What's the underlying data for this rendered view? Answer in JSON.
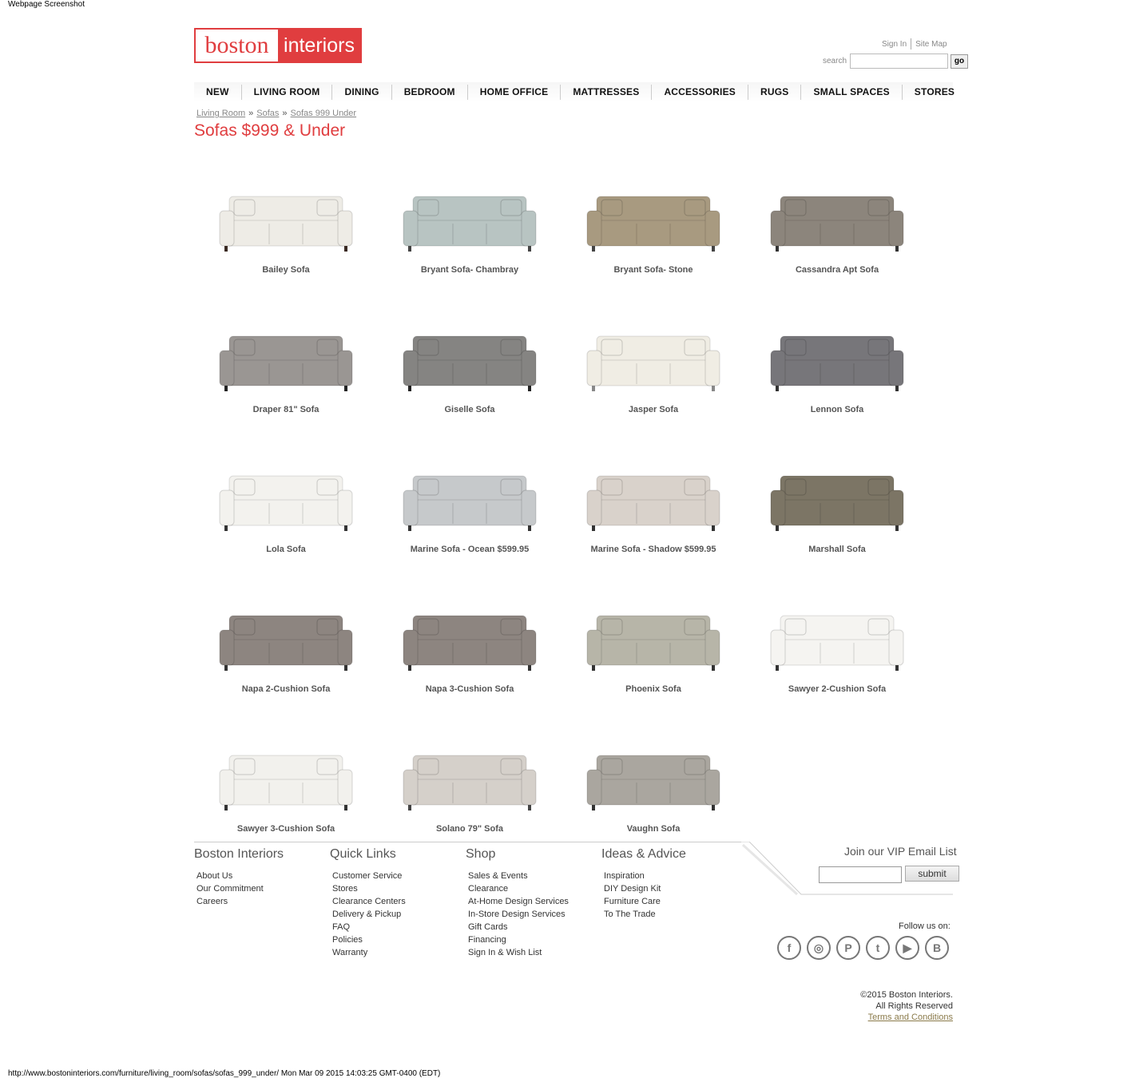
{
  "page_label": "Webpage Screenshot",
  "status_bar": "http://www.bostoninteriors.com/furniture/living_room/sofas/sofas_999_under/ Mon Mar 09 2015 14:03:25 GMT-0400 (EDT)",
  "logo": {
    "part1": "boston",
    "part2": "interiors"
  },
  "colors": {
    "brand_red": "#e03d3f"
  },
  "util_links": {
    "sign_in": "Sign In",
    "site_map": "Site Map"
  },
  "search": {
    "label": "search",
    "value": "",
    "button": "go"
  },
  "nav": [
    "NEW",
    "LIVING ROOM",
    "DINING",
    "BEDROOM",
    "HOME OFFICE",
    "MATTRESSES",
    "ACCESSORIES",
    "RUGS",
    "SMALL SPACES",
    "STORES"
  ],
  "breadcrumb": [
    "Living Room",
    "Sofas",
    "Sofas 999 Under"
  ],
  "breadcrumb_sep": "»",
  "page_title": "Sofas $999 & Under",
  "products": [
    {
      "name": "Bailey Sofa",
      "color": "#eeece6",
      "legs": "#3a2a22"
    },
    {
      "name": "Bryant Sofa- Chambray",
      "color": "#b8c4c2",
      "legs": "#444"
    },
    {
      "name": "Bryant Sofa- Stone",
      "color": "#a89a80",
      "legs": "#444"
    },
    {
      "name": "Cassandra Apt Sofa",
      "color": "#8c857c",
      "legs": "#333"
    },
    {
      "name": "Draper 81\" Sofa",
      "color": "#9a9693",
      "legs": "#222"
    },
    {
      "name": "Giselle Sofa",
      "color": "#858482",
      "legs": "#222"
    },
    {
      "name": "Jasper Sofa",
      "color": "#f0ede4",
      "legs": "#888"
    },
    {
      "name": "Lennon Sofa",
      "color": "#77767a",
      "legs": "#333"
    },
    {
      "name": "Lola Sofa",
      "color": "#f3f2ee",
      "legs": "#333"
    },
    {
      "name": "Marine Sofa - Ocean $599.95",
      "color": "#c6c9cb",
      "legs": "#333"
    },
    {
      "name": "Marine Sofa - Shadow $599.95",
      "color": "#d9d2cb",
      "legs": "#333"
    },
    {
      "name": "Marshall Sofa",
      "color": "#7c7565",
      "legs": "#333"
    },
    {
      "name": "Napa 2-Cushion Sofa",
      "color": "#8d8580",
      "legs": "#333"
    },
    {
      "name": "Napa 3-Cushion Sofa",
      "color": "#8d8580",
      "legs": "#333"
    },
    {
      "name": "Phoenix Sofa",
      "color": "#b7b5a8",
      "legs": "#333"
    },
    {
      "name": "Sawyer 2-Cushion Sofa",
      "color": "#f5f4f1",
      "legs": "#333"
    },
    {
      "name": "Sawyer 3-Cushion Sofa",
      "color": "#f2f1ed",
      "legs": "#333"
    },
    {
      "name": "Solano 79\" Sofa",
      "color": "#d5d0ca",
      "legs": "#444"
    },
    {
      "name": "Vaughn Sofa",
      "color": "#aaa69f",
      "legs": "#333"
    }
  ],
  "footer": {
    "col1": {
      "title": "Boston Interiors",
      "links": [
        "About Us",
        "Our Commitment",
        "Careers"
      ]
    },
    "col2": {
      "title": "Quick Links",
      "links": [
        "Customer Service",
        "Stores",
        "Clearance Centers",
        "Delivery & Pickup",
        "FAQ",
        "Policies",
        "Warranty"
      ]
    },
    "col3": {
      "title": "Shop",
      "links": [
        "Sales & Events",
        "Clearance",
        "At-Home Design Services",
        "In-Store Design Services",
        "Gift Cards",
        "Financing",
        "Sign In & Wish List"
      ]
    },
    "col4": {
      "title": "Ideas & Advice",
      "links": [
        "Inspiration",
        "DIY Design Kit",
        "Furniture Care",
        "To The Trade"
      ]
    },
    "vip_title": "Join our VIP Email List",
    "vip_value": "",
    "vip_submit": "submit",
    "follow": "Follow us on:",
    "social": [
      {
        "icon": "facebook-icon",
        "glyph": "f"
      },
      {
        "icon": "instagram-icon",
        "glyph": "◎"
      },
      {
        "icon": "pinterest-icon",
        "glyph": "P"
      },
      {
        "icon": "twitter-icon",
        "glyph": "t"
      },
      {
        "icon": "youtube-icon",
        "glyph": "▶"
      },
      {
        "icon": "blogger-icon",
        "glyph": "B"
      }
    ],
    "copyright1": "©2015 Boston Interiors.",
    "copyright2": "All Rights Reserved",
    "terms": "Terms and Conditions"
  }
}
